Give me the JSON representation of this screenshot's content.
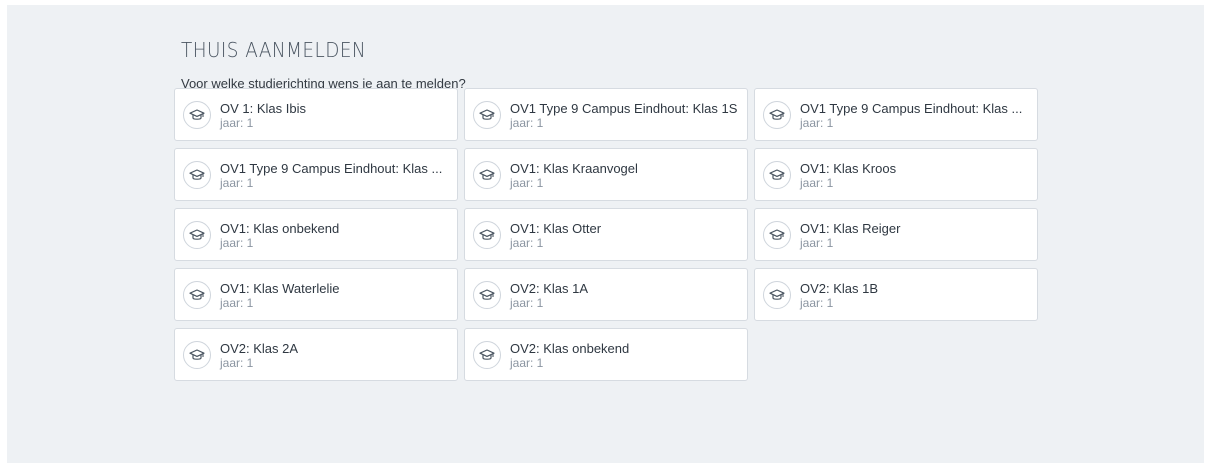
{
  "page": {
    "title": "THUIS AANMELDEN",
    "question": "Voor welke studierichting wens je aan te melden?"
  },
  "options": [
    {
      "name": "OV 1: Klas Ibis",
      "year": "jaar: 1"
    },
    {
      "name": "OV1 Type 9 Campus Eindhout: Klas 1S",
      "year": "jaar: 1"
    },
    {
      "name": "OV1 Type 9 Campus Eindhout: Klas ...",
      "year": "jaar: 1"
    },
    {
      "name": "OV1 Type 9 Campus Eindhout: Klas ...",
      "year": "jaar: 1"
    },
    {
      "name": "OV1: Klas Kraanvogel",
      "year": "jaar: 1"
    },
    {
      "name": "OV1: Klas Kroos",
      "year": "jaar: 1"
    },
    {
      "name": "OV1: Klas onbekend",
      "year": "jaar: 1"
    },
    {
      "name": "OV1: Klas Otter",
      "year": "jaar: 1"
    },
    {
      "name": "OV1: Klas Reiger",
      "year": "jaar: 1"
    },
    {
      "name": "OV1: Klas Waterlelie",
      "year": "jaar: 1"
    },
    {
      "name": "OV2: Klas 1A",
      "year": "jaar: 1"
    },
    {
      "name": "OV2: Klas 1B",
      "year": "jaar: 1"
    },
    {
      "name": "OV2: Klas 2A",
      "year": "jaar: 1"
    },
    {
      "name": "OV2: Klas onbekend",
      "year": "jaar: 1"
    }
  ],
  "icons": {
    "option_icon": "graduation-cap-icon"
  },
  "colors": {
    "background": "#eef1f4",
    "card": "#ffffff",
    "border": "#d6dbe1",
    "text": "#2f3842",
    "muted": "#8b95a1"
  }
}
